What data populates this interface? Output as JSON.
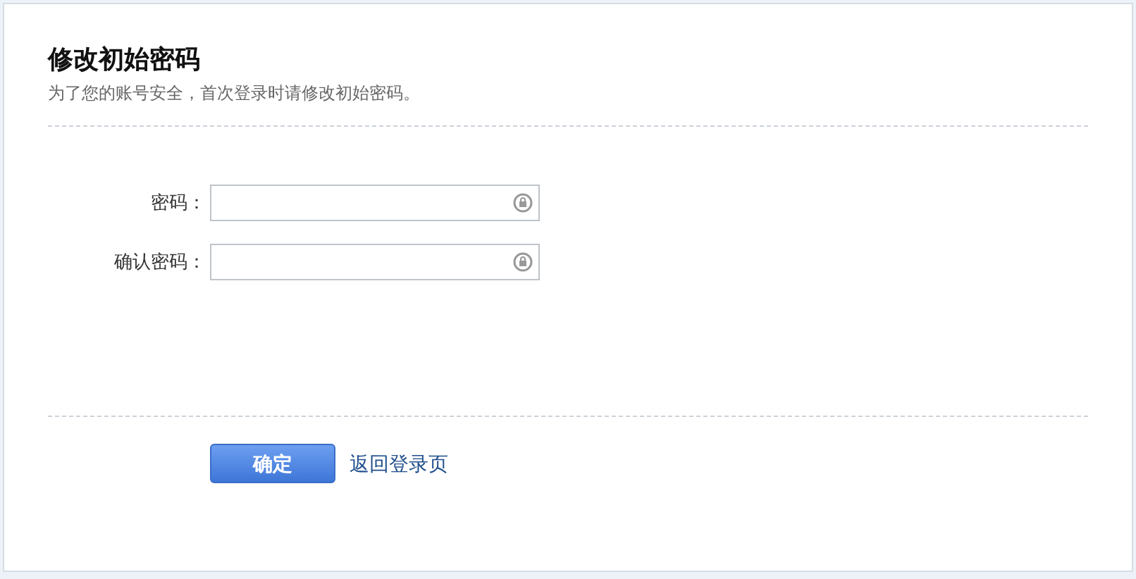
{
  "title": "修改初始密码",
  "subtitle": "为了您的账号安全，首次登录时请修改初始密码。",
  "fields": [
    {
      "label": "密码："
    },
    {
      "label": "确认密码："
    }
  ],
  "submit_button": "确定",
  "back_link": "返回登录页"
}
